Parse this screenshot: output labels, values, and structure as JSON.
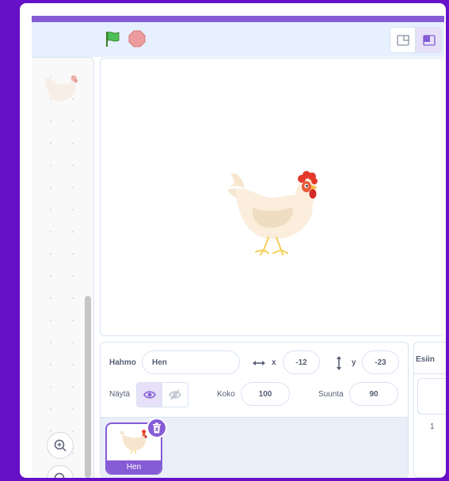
{
  "menubar": {
    "green_flag_icon": "green-flag-icon",
    "stop_icon": "stop-sign-icon",
    "small_stage_icon": "small-stage-layout-icon",
    "normal_stage_icon": "normal-stage-layout-icon"
  },
  "code_area": {
    "zoom_in_icon": "zoom-in-icon",
    "zoom_out_icon": "zoom-out-icon"
  },
  "sprite_info": {
    "sprite_label": "Hahmo",
    "sprite_name": "Hen",
    "x_label": "x",
    "x_value": "-12",
    "y_label": "y",
    "y_value": "-23",
    "show_label": "Näytä",
    "size_label": "Koko",
    "size_value": "100",
    "direction_label": "Suunta",
    "direction_value": "90"
  },
  "sprite_list": {
    "items": [
      {
        "name": "Hen",
        "selected": true
      }
    ]
  },
  "stage_panel": {
    "heading": "Esiin",
    "backdrop_count": "1"
  },
  "colors": {
    "accent": "#855cd6",
    "background": "#6610c8",
    "menubar": "#e6f0ff"
  }
}
